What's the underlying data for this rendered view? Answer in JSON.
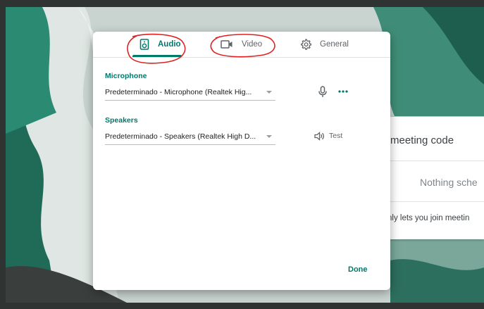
{
  "background": {
    "meeting_code_text": "meeting code",
    "nothing_scheduled_text": "Nothing sche",
    "join_note_text": "nly lets you join meetin"
  },
  "dialog": {
    "tabs": [
      {
        "label": "Audio",
        "icon": "speaker-icon",
        "selected": true
      },
      {
        "label": "Video",
        "icon": "video-camera-icon",
        "selected": false
      },
      {
        "label": "General",
        "icon": "gear-icon",
        "selected": false
      }
    ],
    "microphone": {
      "label": "Microphone",
      "selected": "Predeterminado - Microphone (Realtek Hig..."
    },
    "speakers": {
      "label": "Speakers",
      "selected": "Predeterminado - Speakers (Realtek High D...",
      "test_label": "Test"
    },
    "done_label": "Done"
  },
  "colors": {
    "accent": "#00796b",
    "annotation": "#e02020",
    "dialog_bg": "#ffffff"
  }
}
